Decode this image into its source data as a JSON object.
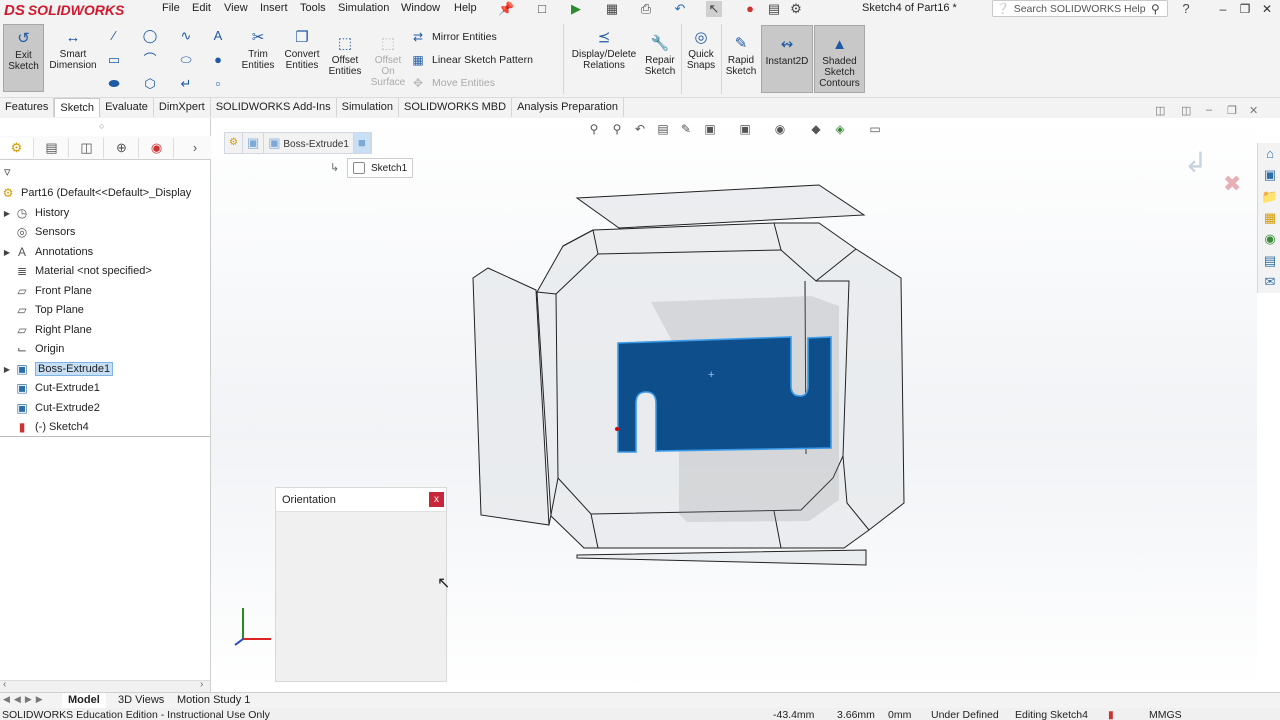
{
  "app": {
    "brand": "SOLIDWORKS",
    "brand_prefix": "DS",
    "doc_title": "Sketch4 of Part16 *"
  },
  "menu": [
    "File",
    "Edit",
    "View",
    "Insert",
    "Tools",
    "Simulation",
    "Window",
    "Help"
  ],
  "search": {
    "placeholder": "Search SOLIDWORKS Help"
  },
  "ribbon": {
    "exit_sketch": "Exit Sketch",
    "smart_dimension": "Smart Dimension",
    "trim_entities": "Trim Entities",
    "convert_entities": "Convert Entities",
    "offset_entities": "Offset Entities",
    "offset_on_surface": "Offset On Surface",
    "mirror_entities": "Mirror Entities",
    "linear_sketch_pattern": "Linear Sketch Pattern",
    "move_entities": "Move Entities",
    "display_delete_relations": "Display/Delete Relations",
    "repair_sketch": "Repair Sketch",
    "quick_snaps": "Quick Snaps",
    "rapid_sketch": "Rapid Sketch",
    "instant2d": "Instant2D",
    "shaded_sketch_contours": "Shaded Sketch Contours"
  },
  "command_tabs": [
    "Features",
    "Sketch",
    "Evaluate",
    "DimXpert",
    "SOLIDWORKS Add-Ins",
    "Simulation",
    "SOLIDWORKS MBD",
    "Analysis Preparation"
  ],
  "active_command_tab": "Sketch",
  "tree": {
    "root": "Part16  (Default<<Default>_Display",
    "items": [
      "History",
      "Sensors",
      "Annotations",
      "Material <not specified>",
      "Front Plane",
      "Top Plane",
      "Right Plane",
      "Origin",
      "Boss-Extrude1",
      "Cut-Extrude1",
      "Cut-Extrude2",
      "(-) Sketch4"
    ],
    "selected": "Boss-Extrude1"
  },
  "breadcrumb": {
    "feature": "Boss-Extrude1",
    "sketch": "Sketch1"
  },
  "orientation": {
    "title": "Orientation",
    "close": "x"
  },
  "bottom_tabs": [
    "Model",
    "3D Views",
    "Motion Study 1"
  ],
  "status": {
    "edition": "SOLIDWORKS Education Edition - Instructional Use Only",
    "x": "-43.4mm",
    "y": "3.66mm",
    "z": "0mm",
    "state": "Under Defined",
    "editing": "Editing Sketch4",
    "units": "MMGS"
  },
  "colors": {
    "accent": "#1e5aa6",
    "sketch_fill": "#0e4f8b",
    "brand_red": "#d1182c"
  }
}
